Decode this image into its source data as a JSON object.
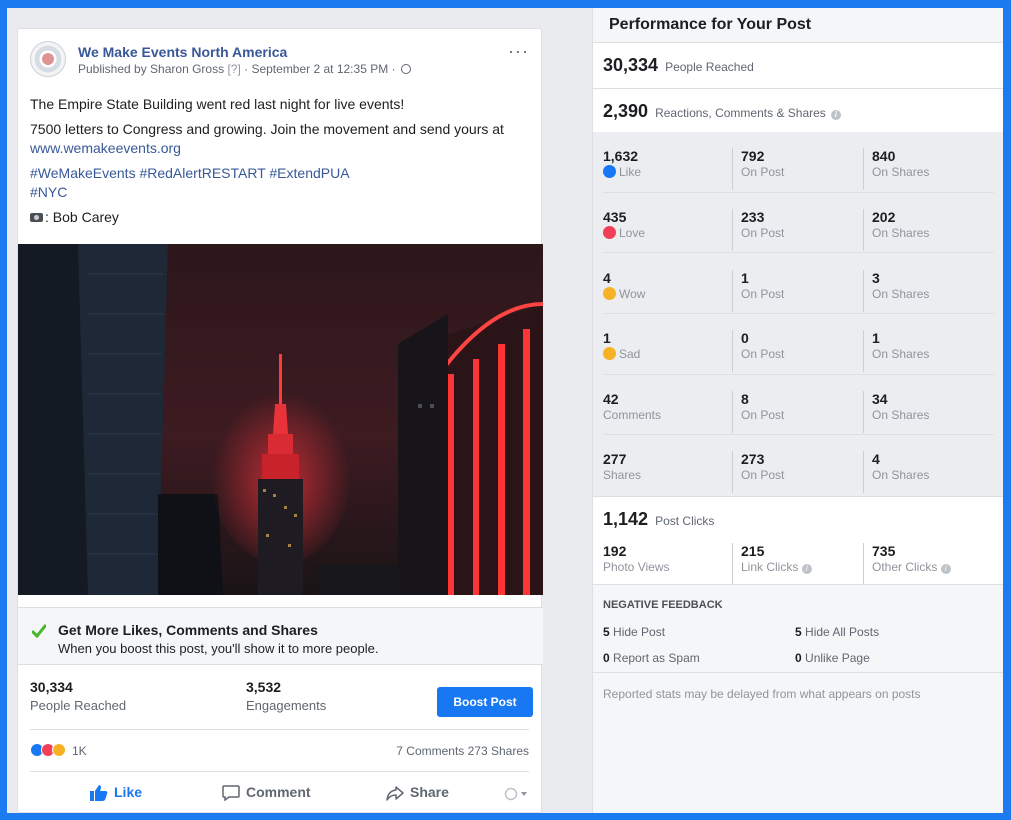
{
  "post": {
    "page_name": "We Make Events North America",
    "published_by": "Published by Sharon Gross",
    "help_mark": "[?]",
    "date": "· September 2 at 12:35 PM ·",
    "menu_glyph": "···",
    "line1": "The Empire State Building went red last night for live events!",
    "line2": "7500 letters to Congress and growing. Join the movement and send yours at",
    "link": "www.wemakeevents.org",
    "hashtags1": "#WeMakeEvents #RedAlertRESTART #ExtendPUA",
    "hashtags2": "#NYC",
    "credit": ": Bob Carey"
  },
  "boost": {
    "title": "Get More Likes, Comments and Shares",
    "subtitle": "When you boost this post, you'll show it to more people.",
    "button": "Boost Post"
  },
  "stats": {
    "reached_value": "30,334",
    "reached_label": "People Reached",
    "engagements_value": "3,532",
    "engagements_label": "Engagements"
  },
  "reactions": {
    "count": "1K",
    "summary": "7 Comments  273 Shares"
  },
  "actions": {
    "like": "Like",
    "comment": "Comment",
    "share": "Share"
  },
  "panel": {
    "title": "Performance for Your Post",
    "reached_value": "30,334",
    "reached_label": "People Reached",
    "rcs_value": "2,390",
    "rcs_label": "Reactions, Comments & Shares",
    "rows": [
      {
        "total": "1,632",
        "label": "Like",
        "on_post": "792",
        "on_shares": "840"
      },
      {
        "total": "435",
        "label": "Love",
        "on_post": "233",
        "on_shares": "202"
      },
      {
        "total": "4",
        "label": "Wow",
        "on_post": "1",
        "on_shares": "3"
      },
      {
        "total": "1",
        "label": "Sad",
        "on_post": "0",
        "on_shares": "1"
      },
      {
        "total": "42",
        "label": "Comments",
        "on_post": "8",
        "on_shares": "34"
      },
      {
        "total": "277",
        "label": "Shares",
        "on_post": "273",
        "on_shares": "4"
      }
    ],
    "on_post_label": "On Post",
    "on_shares_label": "On Shares",
    "clicks_value": "1,142",
    "clicks_label": "Post Clicks",
    "photo_views_value": "192",
    "photo_views_label": "Photo Views",
    "link_clicks_value": "215",
    "link_clicks_label": "Link Clicks",
    "other_clicks_value": "735",
    "other_clicks_label": "Other Clicks",
    "negative_title": "NEGATIVE FEEDBACK",
    "hide_post_value": "5",
    "hide_post_label": "Hide Post",
    "hide_all_value": "5",
    "hide_all_label": "Hide All Posts",
    "spam_value": "0",
    "spam_label": "Report as Spam",
    "unlike_value": "0",
    "unlike_label": "Unlike Page",
    "footnote": "Reported stats may be delayed from what appears on posts"
  },
  "colors": {
    "accent": "#1877f2",
    "link": "#385898",
    "love": "#f33e58",
    "wow": "#f7b125"
  }
}
